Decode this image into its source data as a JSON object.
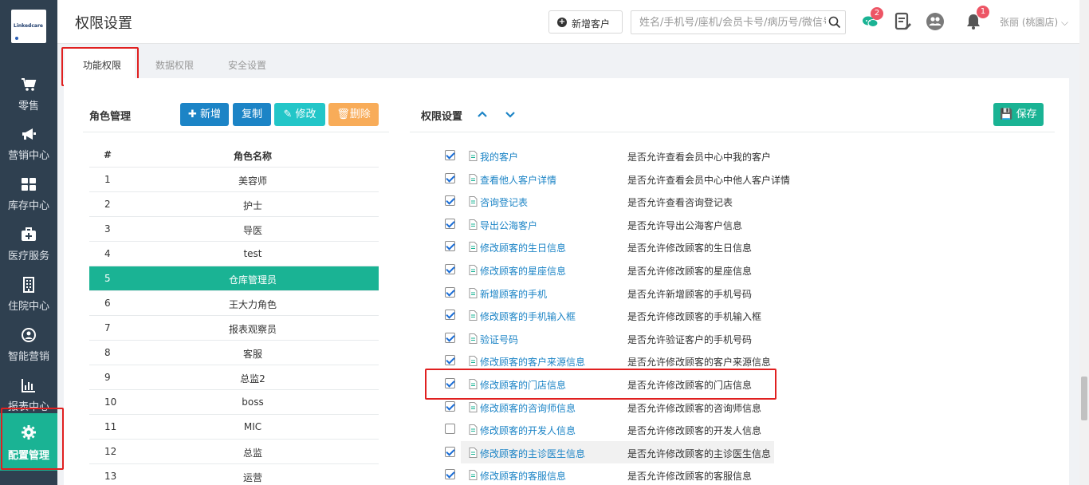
{
  "app": {
    "logo_text": "Linkedcare"
  },
  "sidebar": {
    "items": [
      {
        "label": "零售",
        "icon": "cart-icon"
      },
      {
        "label": "营销中心",
        "icon": "megaphone-icon"
      },
      {
        "label": "库存中心",
        "icon": "grid-icon"
      },
      {
        "label": "医疗服务",
        "icon": "medkit-icon"
      },
      {
        "label": "住院中心",
        "icon": "building-icon"
      },
      {
        "label": "智能营销",
        "icon": "target-icon"
      },
      {
        "label": "报表中心",
        "icon": "bar-chart-icon"
      },
      {
        "label": "配置管理",
        "icon": "gear-icon"
      }
    ],
    "active_index": 7
  },
  "header": {
    "title": "权限设置",
    "new_customer_label": "新增客户",
    "search_placeholder": "姓名/手机号/座机/会员卡号/病历号/微信号",
    "chat_badge": "2",
    "notification_badge": "1",
    "user_name": "张丽 (桃園店)"
  },
  "tabs": [
    {
      "label": "功能权限",
      "active": true
    },
    {
      "label": "数据权限",
      "active": false
    },
    {
      "label": "安全设置",
      "active": false
    }
  ],
  "role_management": {
    "title": "角色管理",
    "buttons": {
      "add": "新增",
      "copy": "复制",
      "edit": "修改",
      "delete": "删除"
    },
    "columns": [
      "#",
      "角色名称"
    ],
    "rows": [
      {
        "num": "1",
        "name": "美容师"
      },
      {
        "num": "2",
        "name": "护士"
      },
      {
        "num": "3",
        "name": "导医"
      },
      {
        "num": "4",
        "name": "test"
      },
      {
        "num": "5",
        "name": "仓库管理员"
      },
      {
        "num": "6",
        "name": "王大力角色"
      },
      {
        "num": "7",
        "name": "报表观察员"
      },
      {
        "num": "8",
        "name": "客服"
      },
      {
        "num": "9",
        "name": "总监2"
      },
      {
        "num": "10",
        "name": "boss"
      },
      {
        "num": "11",
        "name": "MIC"
      },
      {
        "num": "12",
        "name": "总监"
      },
      {
        "num": "13",
        "name": "运营"
      }
    ],
    "selected_index": 4
  },
  "permission_settings": {
    "title": "权限设置",
    "save_label": "保存",
    "items": [
      {
        "name": "我的客户",
        "desc": "是否允许查看会员中心中我的客户",
        "checked": true
      },
      {
        "name": "查看他人客户详情",
        "desc": "是否允许查看会员中心中他人客户详情",
        "checked": true
      },
      {
        "name": "咨询登记表",
        "desc": "是否允许查看咨询登记表",
        "checked": true
      },
      {
        "name": "导出公海客户",
        "desc": "是否允许导出公海客户信息",
        "checked": true
      },
      {
        "name": "修改顾客的生日信息",
        "desc": "是否允许修改顾客的生日信息",
        "checked": true
      },
      {
        "name": "修改顾客的星座信息",
        "desc": "是否允许修改顾客的星座信息",
        "checked": true
      },
      {
        "name": "新增顾客的手机",
        "desc": "是否允许新增顾客的手机号码",
        "checked": true
      },
      {
        "name": "修改顾客的手机输入框",
        "desc": "是否允许修改顾客的手机输入框",
        "checked": true
      },
      {
        "name": "验证号码",
        "desc": "是否允许验证客户的手机号码",
        "checked": true
      },
      {
        "name": "修改顾客的客户来源信息",
        "desc": "是否允许修改顾客的客户来源信息",
        "checked": true
      },
      {
        "name": "修改顾客的门店信息",
        "desc": "是否允许修改顾客的门店信息",
        "checked": true
      },
      {
        "name": "修改顾客的咨询师信息",
        "desc": "是否允许修改顾客的咨询师信息",
        "checked": true
      },
      {
        "name": "修改顾客的开发人信息",
        "desc": "是否允许修改顾客的开发人信息",
        "checked": false
      },
      {
        "name": "修改顾客的主诊医生信息",
        "desc": "是否允许修改顾客的主诊医生信息",
        "checked": true
      },
      {
        "name": "修改顾客的客服信息",
        "desc": "是否允许修改顾客的客服信息",
        "checked": true
      }
    ]
  },
  "colors": {
    "sidebar_bg": "#2f4050",
    "accent_green": "#1ab394",
    "primary_blue": "#1c84c6",
    "teal": "#23c6c8",
    "orange": "#f8ac59",
    "badge_red": "#ed5565",
    "highlight_red": "#e02020"
  }
}
